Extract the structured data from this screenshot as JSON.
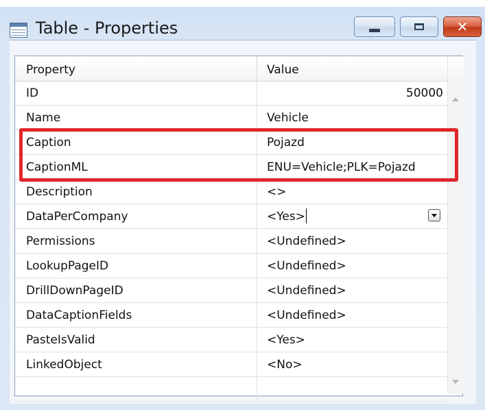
{
  "window": {
    "title": "Table - Properties",
    "icon": "table-icon",
    "controls": {
      "minimize": "minimize-icon",
      "maximize": "maximize-icon",
      "close": "close-icon"
    }
  },
  "grid": {
    "headers": {
      "property": "Property",
      "value": "Value"
    },
    "rows": [
      {
        "property": "ID",
        "value": "50000"
      },
      {
        "property": "Name",
        "value": "Vehicle"
      },
      {
        "property": "Caption",
        "value": "Pojazd"
      },
      {
        "property": "CaptionML",
        "value": "ENU=Vehicle;PLK=Pojazd"
      },
      {
        "property": "Description",
        "value": "<>"
      },
      {
        "property": "DataPerCompany",
        "value": "<Yes>"
      },
      {
        "property": "Permissions",
        "value": "<Undefined>"
      },
      {
        "property": "LookupPageID",
        "value": "<Undefined>"
      },
      {
        "property": "DrillDownPageID",
        "value": "<Undefined>"
      },
      {
        "property": "DataCaptionFields",
        "value": "<Undefined>"
      },
      {
        "property": "PasteIsValid",
        "value": "<Yes>"
      },
      {
        "property": "LinkedObject",
        "value": "<No>"
      },
      {
        "property": "",
        "value": ""
      }
    ]
  },
  "highlight_color": "#e0262b",
  "close_color": "#c2391b"
}
